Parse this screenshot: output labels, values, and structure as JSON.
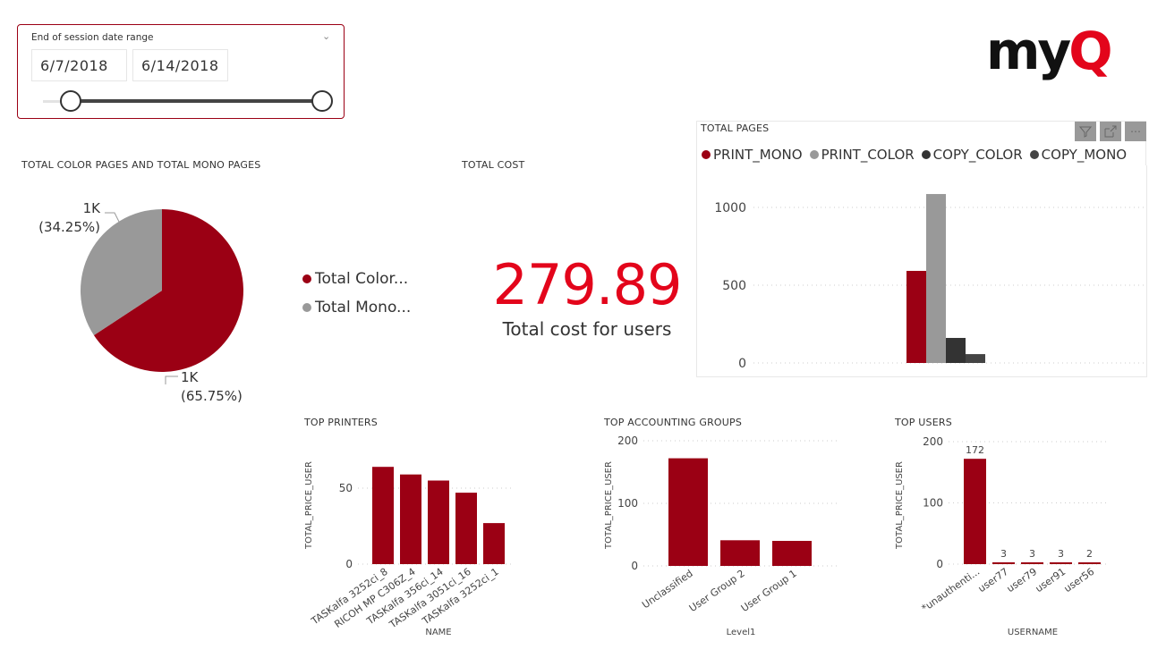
{
  "slicer": {
    "title": "End of session date range",
    "start_date": "6/7/2018",
    "end_date": "6/14/2018",
    "range_start_fraction": 0.0,
    "range_end_fraction": 1.0
  },
  "logo": {
    "text_dark": "my",
    "text_accent": "Q"
  },
  "colors": {
    "accent": "#9b0014",
    "kpi_red": "#e3051b",
    "gray": "#999999",
    "dark": "#333333",
    "dark2": "#444444"
  },
  "pie_visual": {
    "title": "TOTAL COLOR PAGES AND TOTAL MONO PAGES",
    "legend": [
      "Total Color...",
      "Total Mono..."
    ]
  },
  "kpi": {
    "title": "TOTAL COST",
    "value": "279.89",
    "label": "Total cost for users"
  },
  "total_pages_visual": {
    "title": "TOTAL PAGES",
    "toolbar": {
      "filter_icon": "filter-icon",
      "focus_icon": "focus-mode-icon",
      "more_icon": "more-options-icon"
    }
  },
  "top_printers_visual": {
    "title": "TOP PRINTERS"
  },
  "top_groups_visual": {
    "title": "TOP ACCOUNTING GROUPS"
  },
  "top_users_visual": {
    "title": "TOP USERS"
  },
  "chart_data": [
    {
      "id": "pie",
      "type": "pie",
      "title": "TOTAL COLOR PAGES AND TOTAL MONO PAGES",
      "categories": [
        "Total Color Pages",
        "Total Mono Pages"
      ],
      "values": [
        65.75,
        34.25
      ],
      "data_labels": [
        [
          "1K",
          "(65.75%)"
        ],
        [
          "1K",
          "(34.25%)"
        ]
      ],
      "colors": [
        "#9b0014",
        "#999999"
      ],
      "legend": "right"
    },
    {
      "id": "total_pages",
      "type": "bar",
      "title": "TOTAL PAGES",
      "categories": [
        ""
      ],
      "series": [
        {
          "name": "PRINT_MONO",
          "values": [
            592
          ],
          "color": "#9b0014"
        },
        {
          "name": "PRINT_COLOR",
          "values": [
            1086
          ],
          "color": "#999999"
        },
        {
          "name": "COPY_COLOR",
          "values": [
            161
          ],
          "color": "#333333"
        },
        {
          "name": "COPY_MONO",
          "values": [
            57
          ],
          "color": "#444444"
        }
      ],
      "yticks": [
        "0",
        "500",
        "1000"
      ],
      "ylim": [
        0,
        1086
      ],
      "grid": true,
      "legend": "top-left"
    },
    {
      "id": "top_printers",
      "type": "bar",
      "title": "TOP PRINTERS",
      "categories": [
        "TASKalfa 3252ci_8",
        "RICOH MP C306Z_4",
        "TASKalfa 356ci_14",
        "TASKalfa 3051ci_16",
        "TASKalfa 3252ci_1"
      ],
      "values": [
        64,
        59,
        55,
        47,
        27
      ],
      "xlabel": "NAME",
      "ylabel": "TOTAL_PRICE_USER",
      "yticks": [
        "0",
        "50"
      ],
      "ylim": [
        0,
        70
      ],
      "grid": true
    },
    {
      "id": "top_groups",
      "type": "bar",
      "title": "TOP ACCOUNTING GROUPS",
      "categories": [
        "Unclassified",
        "User Group 2",
        "User Group 1"
      ],
      "values": [
        172,
        41,
        40
      ],
      "xlabel": "Level1",
      "ylabel": "TOTAL_PRICE_USER",
      "yticks": [
        "0",
        "100",
        "200"
      ],
      "ylim": [
        0,
        200
      ],
      "grid": true
    },
    {
      "id": "top_users",
      "type": "bar",
      "title": "TOP USERS",
      "categories": [
        "*unauthenti...",
        "user77",
        "user79",
        "user91",
        "user56"
      ],
      "values": [
        172,
        3,
        3,
        3,
        2
      ],
      "data_labels": [
        "172",
        "3",
        "3",
        "3",
        "2"
      ],
      "xlabel": "USERNAME",
      "ylabel": "TOTAL_PRICE_USER",
      "yticks": [
        "0",
        "100",
        "200"
      ],
      "ylim": [
        0,
        200
      ],
      "grid": true
    }
  ]
}
